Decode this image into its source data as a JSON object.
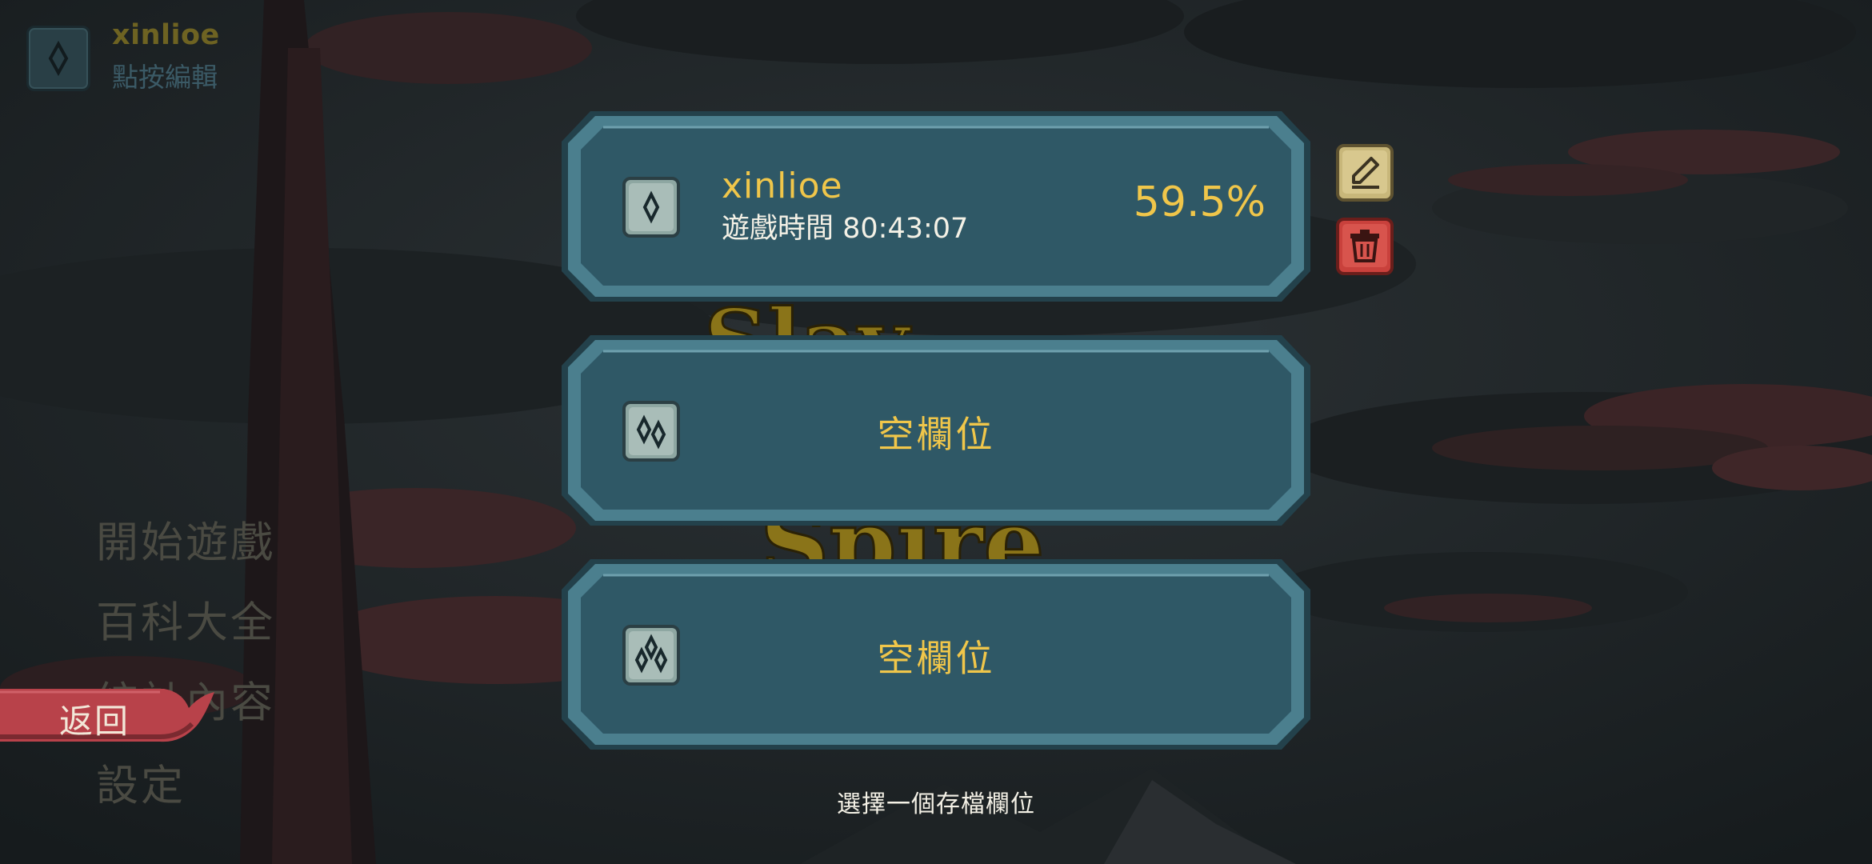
{
  "profile": {
    "name": "xinlioe",
    "edit_hint": "點按編輯"
  },
  "menu": {
    "items": [
      "開始遊戲",
      "百科大全",
      "統計內容",
      "設定"
    ],
    "back_label": "返回"
  },
  "slots": [
    {
      "name": "xinlioe",
      "playtime": "遊戲時間 80:43:07",
      "progress": "59.5%"
    },
    {
      "label": "空欄位"
    },
    {
      "label": "空欄位"
    }
  ],
  "prompt": "選擇一個存檔欄位",
  "colors": {
    "panel": "#2f5866",
    "panel_edge": "#4b7f8e",
    "gold_text": "#f0c64a",
    "rename_button": "#c8b77a",
    "delete_button": "#c9413c",
    "back_banner": "#b8424a"
  },
  "icons": {
    "rename": "pencil-icon",
    "delete": "trash-icon"
  }
}
